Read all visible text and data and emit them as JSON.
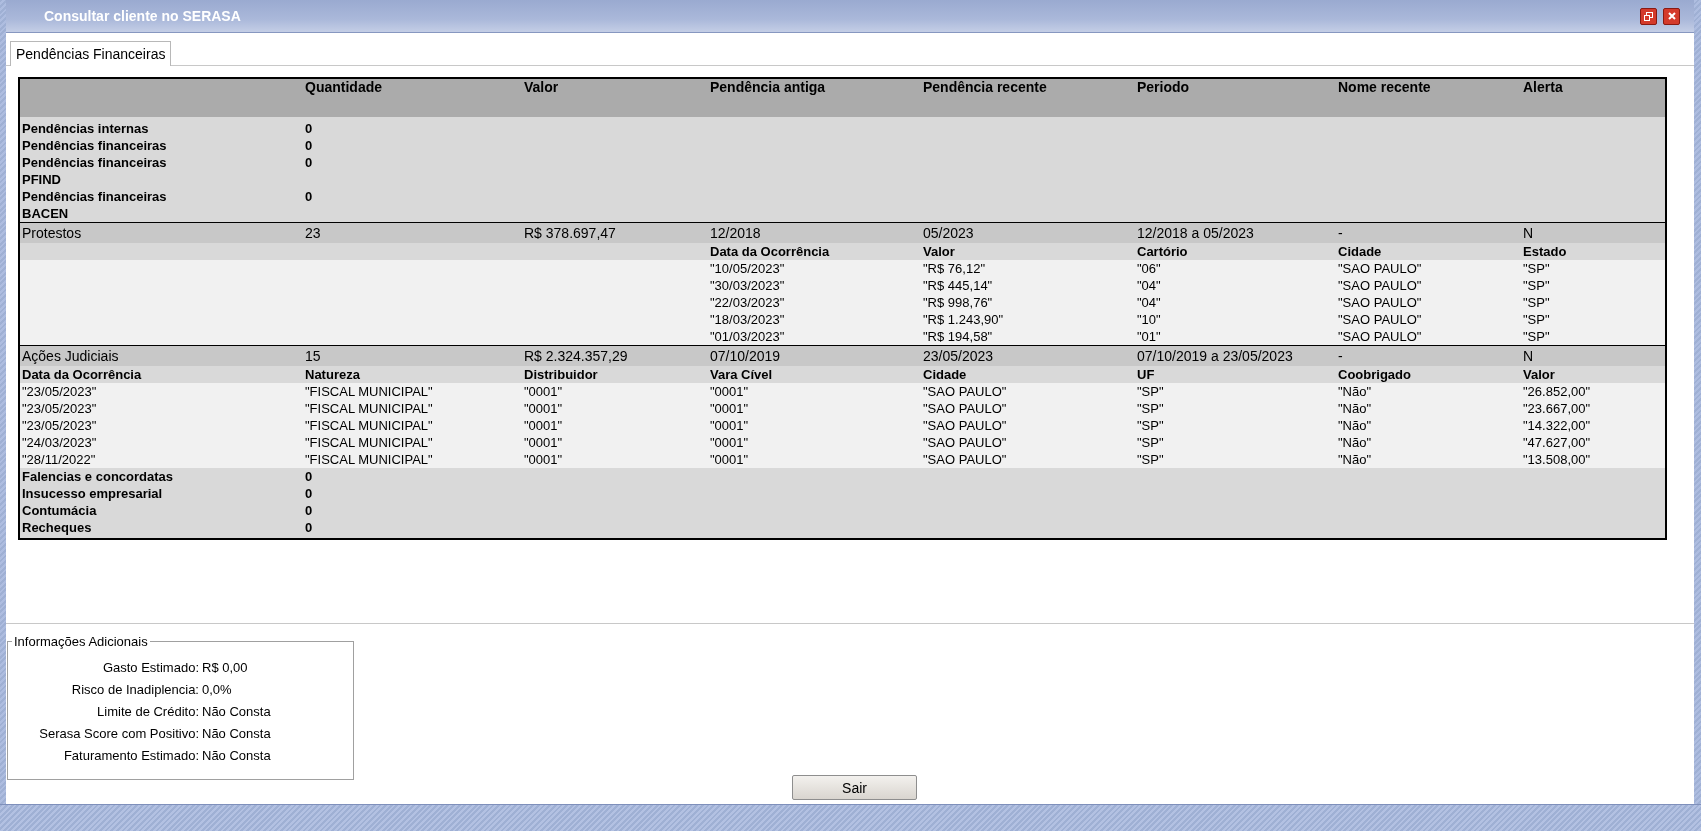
{
  "window": {
    "title": "Consultar cliente no SERASA"
  },
  "tabs": [
    {
      "label": "Pendências Financeiras",
      "selected": true
    }
  ],
  "table": {
    "columns": [
      "Quantidade",
      "Valor",
      "Pendência antiga",
      "Pendência recente",
      "Periodo",
      "Nome recente",
      "Alerta"
    ],
    "summary_rows": [
      {
        "label": "Pendências internas",
        "value": "0"
      },
      {
        "label": "Pendências financeiras",
        "value": "0"
      },
      {
        "label": "Pendências financeiras PFIND",
        "value": "0"
      },
      {
        "label": "Pendências financeiras BACEN",
        "value": "0"
      }
    ],
    "sections": [
      {
        "cells": [
          "Protestos",
          "23",
          "R$ 378.697,47",
          "12/2018",
          "05/2023",
          "12/2018 a 05/2023",
          "-",
          "N"
        ],
        "detail_columns": [
          "Data da Ocorrência",
          "Valor",
          "Cartório",
          "Cidade",
          "Estado"
        ],
        "detail_rows": [
          [
            "\"10/05/2023\"",
            "\"R$ 76,12\"",
            "\"06\"",
            "\"SAO PAULO\"",
            "\"SP\""
          ],
          [
            "\"30/03/2023\"",
            "\"R$ 445,14\"",
            "\"04\"",
            "\"SAO PAULO\"",
            "\"SP\""
          ],
          [
            "\"22/03/2023\"",
            "\"R$ 998,76\"",
            "\"04\"",
            "\"SAO PAULO\"",
            "\"SP\""
          ],
          [
            "\"18/03/2023\"",
            "\"R$ 1.243,90\"",
            "\"10\"",
            "\"SAO PAULO\"",
            "\"SP\""
          ],
          [
            "\"01/03/2023\"",
            "\"R$ 194,58\"",
            "\"01\"",
            "\"SAO PAULO\"",
            "\"SP\""
          ]
        ]
      },
      {
        "cells": [
          "Ações Judiciais",
          "15",
          "R$ 2.324.357,29",
          "07/10/2019",
          "23/05/2023",
          "07/10/2019 a 23/05/2023",
          "-",
          "N"
        ],
        "detail_columns": [
          "Data da Ocorrência",
          "Natureza",
          "Distribuidor",
          "Vara Cível",
          "Cidade",
          "UF",
          "Coobrigado",
          "Valor"
        ],
        "detail_rows": [
          [
            "\"23/05/2023\"",
            "\"FISCAL MUNICIPAL\"",
            "\"0001\"",
            "\"0001\"",
            "\"SAO PAULO\"",
            "\"SP\"",
            "\"Não\"",
            "\"26.852,00\""
          ],
          [
            "\"23/05/2023\"",
            "\"FISCAL MUNICIPAL\"",
            "\"0001\"",
            "\"0001\"",
            "\"SAO PAULO\"",
            "\"SP\"",
            "\"Não\"",
            "\"23.667,00\""
          ],
          [
            "\"23/05/2023\"",
            "\"FISCAL MUNICIPAL\"",
            "\"0001\"",
            "\"0001\"",
            "\"SAO PAULO\"",
            "\"SP\"",
            "\"Não\"",
            "\"14.322,00\""
          ],
          [
            "\"24/03/2023\"",
            "\"FISCAL MUNICIPAL\"",
            "\"0001\"",
            "\"0001\"",
            "\"SAO PAULO\"",
            "\"SP\"",
            "\"Não\"",
            "\"47.627,00\""
          ],
          [
            "\"28/11/2022\"",
            "\"FISCAL MUNICIPAL\"",
            "\"0001\"",
            "\"0001\"",
            "\"SAO PAULO\"",
            "\"SP\"",
            "\"Não\"",
            "\"13.508,00\""
          ]
        ]
      }
    ],
    "footer_rows": [
      {
        "label": "Falencias e concordatas",
        "value": "0"
      },
      {
        "label": "Insucesso empresarial",
        "value": "0"
      },
      {
        "label": "Contumácia",
        "value": "0"
      },
      {
        "label": "Recheques",
        "value": "0"
      }
    ]
  },
  "additional_info": {
    "title": "Informações Adicionais",
    "items": [
      {
        "label": "Gasto Estimado:",
        "value": "R$ 0,00"
      },
      {
        "label": "Risco de Inadiplencia:",
        "value": "0,0%"
      },
      {
        "label": "Limite de Crédito:",
        "value": "Não Consta"
      },
      {
        "label": "Serasa Score com Positivo:",
        "value": "Não Consta"
      },
      {
        "label": "Faturamento Estimado:",
        "value": "Não Consta"
      }
    ]
  },
  "buttons": [
    {
      "label": "Sair"
    }
  ]
}
